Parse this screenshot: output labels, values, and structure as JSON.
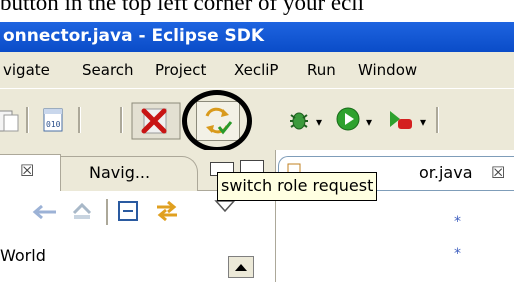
{
  "caption": {
    "text": "button in the top left corner of your ecli"
  },
  "window": {
    "title": "onnector.java - Eclipse SDK"
  },
  "menu": {
    "items": [
      "vigate",
      "Search",
      "Project",
      "XecliP",
      "Run",
      "Window"
    ]
  },
  "toolbar": {
    "icons": [
      "copy-icon",
      "binary-file-icon",
      "disconnect-icon",
      "switch-role-icon",
      "debug-icon",
      "run-icon",
      "external-tools-icon"
    ]
  },
  "tooltip": {
    "text": "switch role request"
  },
  "nav_panel": {
    "tab_close_glyph": "☒",
    "tab_label": "Navig...",
    "tree_item": "World"
  },
  "editor": {
    "tab_label": "or.java",
    "tab_close_glyph": "☒",
    "line_markers": [
      "*",
      "*"
    ]
  },
  "colors": {
    "titlebar": "#0a4cc8",
    "chrome": "#ece9d8",
    "tooltip_bg": "#ffffe1"
  }
}
